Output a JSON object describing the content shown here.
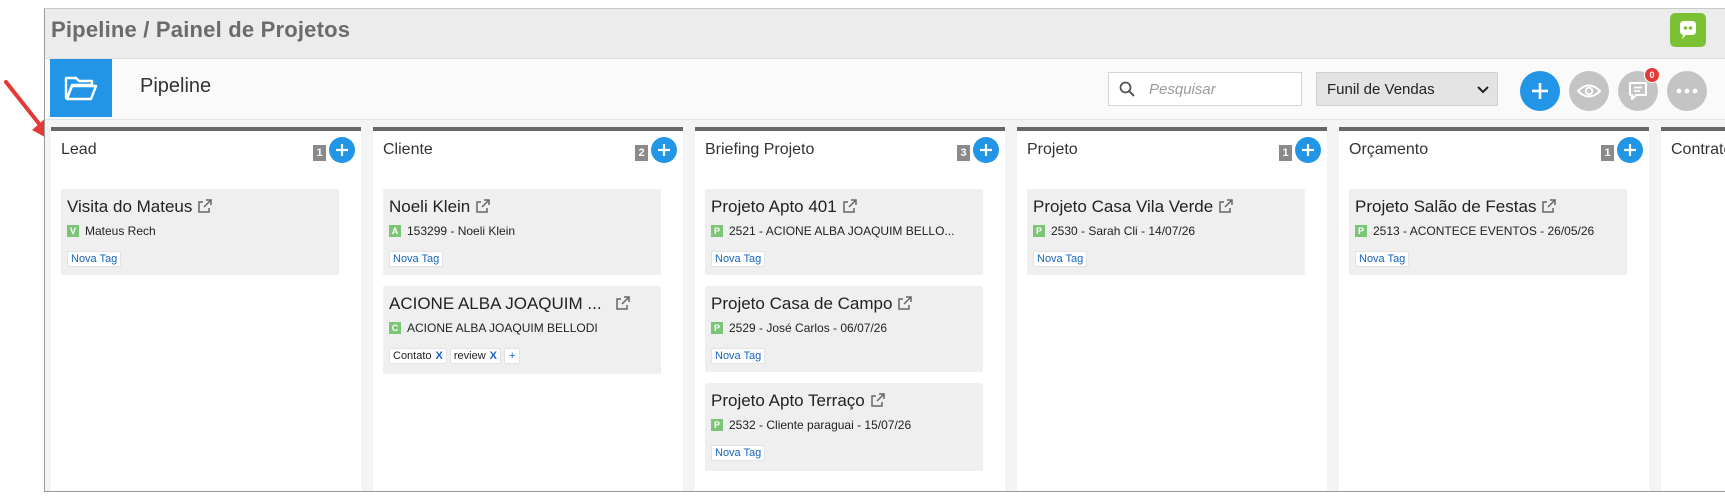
{
  "header": {
    "breadcrumb": "Pipeline / Painel de Projetos",
    "app_icon": "chat-bot-icon",
    "accent_color": "#7cc034"
  },
  "toolbar": {
    "folder_icon": "folder-open-icon",
    "title": "Pipeline",
    "search_placeholder": "Pesquisar",
    "funnel_selected": "Funil de Vendas",
    "buttons": [
      "add-icon",
      "eye-icon",
      "chat-icon",
      "more-icon"
    ],
    "notification_count": "0",
    "primary_color": "#2295e7"
  },
  "columns": [
    {
      "title": "Lead",
      "count": "1",
      "cards": [
        {
          "title": "Visita do Mateus",
          "letter": "V",
          "subtitle": "Mateus Rech",
          "tags": [
            {
              "label": "Nova Tag"
            }
          ]
        }
      ]
    },
    {
      "title": "Cliente",
      "count": "2",
      "cards": [
        {
          "title": "Noeli Klein",
          "letter": "A",
          "subtitle": "153299 - Noeli Klein",
          "tags": [
            {
              "label": "Nova Tag"
            }
          ]
        },
        {
          "title": "ACIONE ALBA JOAQUIM ...",
          "letter": "C",
          "subtitle": "ACIONE ALBA JOAQUIM BELLODI",
          "tags": [
            {
              "label": "Contato",
              "remove": "X"
            },
            {
              "label": "review",
              "remove": "X"
            },
            {
              "label": "+"
            }
          ]
        }
      ]
    },
    {
      "title": "Briefing Projeto",
      "count": "3",
      "cards": [
        {
          "title": "Projeto Apto 401",
          "letter": "P",
          "subtitle": "2521 - ACIONE ALBA JOAQUIM BELLO...",
          "tags": [
            {
              "label": "Nova Tag"
            }
          ]
        },
        {
          "title": "Projeto Casa de Campo",
          "letter": "P",
          "subtitle": "2529 - José Carlos - 06/07/26",
          "tags": [
            {
              "label": "Nova Tag"
            }
          ]
        },
        {
          "title": "Projeto Apto Terraço",
          "letter": "P",
          "subtitle": "2532 - Cliente paraguai - 15/07/26",
          "tags": [
            {
              "label": "Nova Tag"
            }
          ]
        }
      ]
    },
    {
      "title": "Projeto",
      "count": "1",
      "cards": [
        {
          "title": "Projeto Casa Vila Verde",
          "letter": "P",
          "subtitle": "2530 - Sarah Cli - 14/07/26",
          "tags": [
            {
              "label": "Nova Tag"
            }
          ]
        }
      ]
    },
    {
      "title": "Orçamento",
      "count": "1",
      "cards": [
        {
          "title": "Projeto Salão de Festas",
          "letter": "P",
          "subtitle": "2513 - ACONTECE EVENTOS - 26/05/26",
          "tags": [
            {
              "label": "Nova Tag"
            }
          ]
        }
      ]
    },
    {
      "title": "Contrato",
      "count": "",
      "cards": []
    }
  ],
  "annotation": {
    "icon": "red-arrow-icon",
    "color": "#e53935"
  }
}
